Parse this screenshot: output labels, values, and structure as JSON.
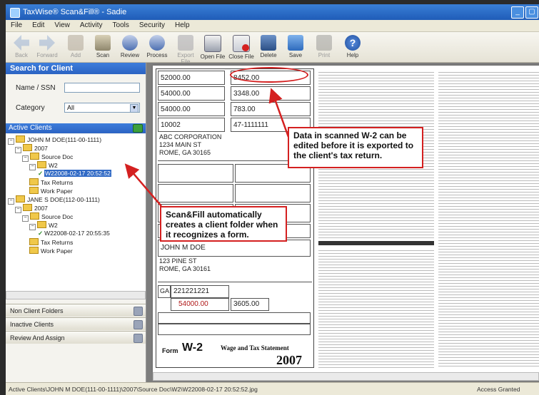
{
  "window": {
    "title": "TaxWise® Scan&Fill® - Sadie",
    "controls": [
      "_",
      "▢"
    ]
  },
  "menu": [
    "File",
    "Edit",
    "View",
    "Activity",
    "Tools",
    "Security",
    "Help"
  ],
  "toolbar": [
    {
      "label": "Back",
      "icon": "back-arrow-icon",
      "enabled": false
    },
    {
      "label": "Forward",
      "icon": "forward-arrow-icon",
      "enabled": false
    },
    {
      "label": "Add",
      "icon": "add-icon",
      "enabled": false
    },
    {
      "label": "Scan",
      "icon": "scan-icon",
      "enabled": true
    },
    {
      "label": "Review",
      "icon": "review-icon",
      "enabled": true
    },
    {
      "label": "Process",
      "icon": "process-icon",
      "enabled": true
    },
    {
      "label": "Export File",
      "icon": "export-icon",
      "enabled": false
    },
    {
      "label": "Open File",
      "icon": "open-file-icon",
      "enabled": true
    },
    {
      "label": "Close File",
      "icon": "close-file-icon",
      "enabled": true
    },
    {
      "label": "Delete",
      "icon": "delete-icon",
      "enabled": true
    },
    {
      "label": "Save",
      "icon": "save-icon",
      "enabled": true
    },
    {
      "label": "Print",
      "icon": "print-icon",
      "enabled": false
    },
    {
      "label": "Help",
      "icon": "help-icon",
      "enabled": true
    }
  ],
  "search": {
    "header": "Search for Client",
    "name_label": "Name / SSN",
    "name_value": "",
    "category_label": "Category",
    "category_value": "All"
  },
  "active_clients": {
    "header": "Active Clients",
    "tree": [
      {
        "level": 0,
        "label": "JOHN M DOE(111-00-1111)",
        "type": "client",
        "expanded": true
      },
      {
        "level": 1,
        "label": "2007",
        "type": "folder",
        "expanded": true
      },
      {
        "level": 2,
        "label": "Source Doc",
        "type": "folder",
        "expanded": true
      },
      {
        "level": 3,
        "label": "W2",
        "type": "folder",
        "expanded": true
      },
      {
        "level": 4,
        "label": "W22008-02-17 20:52:52",
        "type": "file",
        "selected": true
      },
      {
        "level": 2,
        "label": "Tax Returns",
        "type": "folder"
      },
      {
        "level": 2,
        "label": "Work Paper",
        "type": "folder"
      },
      {
        "level": 0,
        "label": "JANE S DOE(112-00-1111)",
        "type": "client",
        "expanded": true
      },
      {
        "level": 1,
        "label": "2007",
        "type": "folder",
        "expanded": true
      },
      {
        "level": 2,
        "label": "Source Doc",
        "type": "folder",
        "expanded": true
      },
      {
        "level": 3,
        "label": "W2",
        "type": "folder",
        "expanded": true
      },
      {
        "level": 4,
        "label": "W22008-02-17 20:55:35",
        "type": "file",
        "selected": false
      },
      {
        "level": 2,
        "label": "Tax Returns",
        "type": "folder"
      },
      {
        "level": 2,
        "label": "Work Paper",
        "type": "folder"
      }
    ]
  },
  "bottom_tabs": [
    "Non Client Folders",
    "Inactive Clients",
    "Review And Assign"
  ],
  "w2": {
    "wages": "52000.00",
    "federal_tax": "8452.00",
    "ss_wages": "54000.00",
    "ss_tax": "3348.00",
    "medicare_wages": "54000.00",
    "medicare_tax": "783.00",
    "control": "10002",
    "ein": "47-1111111",
    "employer_name": "ABC CORPORATION",
    "employer_street": "1234 MAIN ST",
    "employer_city": "ROME, GA 30165",
    "employee_name": "JOHN M DOE",
    "employee_street": "123 PINE ST",
    "employee_city": "ROME, GA 30161",
    "state": "GA",
    "state_id": "221221221",
    "state_wages": "54000.00",
    "state_tax": "3605.00",
    "form_label": "Form",
    "form_name": "W-2",
    "form_title": "Wage and Tax Statement",
    "form_year": "2007"
  },
  "callouts": {
    "edit": "Data in scanned W-2 can be edited before it is exported to the client's tax return.",
    "folder": "Scan&Fill automatically creates a client folder when it recognizes a form."
  },
  "status": {
    "path": "Active Clients\\JOHN M DOE(111-00-1111)\\2007\\Source Doc\\W2\\W22008-02-17 20:52:52.jpg",
    "right": "Access Granted"
  },
  "colors": {
    "accent": "#2b63c3",
    "callout_border": "#d42020",
    "title_blue": "#1f5cb8"
  }
}
